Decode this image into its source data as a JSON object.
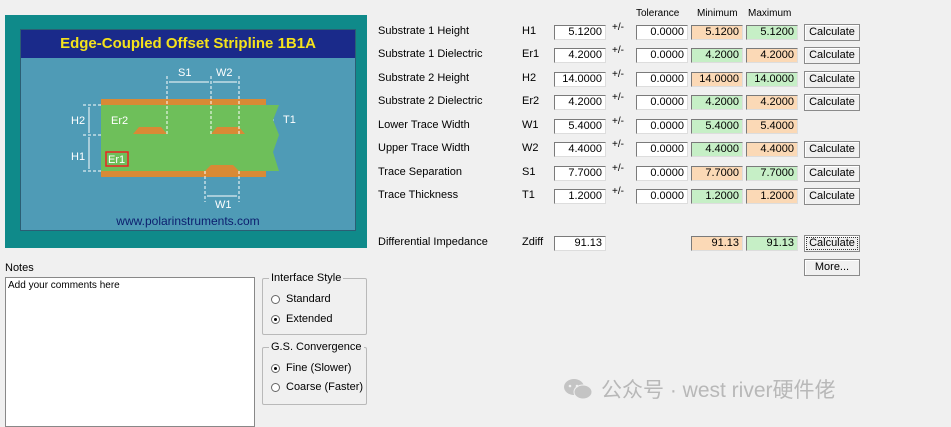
{
  "diagram": {
    "title": "Edge-Coupled Offset Stripline 1B1A",
    "url": "www.polarinstruments.com",
    "labels": {
      "s1": "S1",
      "w2": "W2",
      "t1": "T1",
      "h2": "H2",
      "er2": "Er2",
      "h1": "H1",
      "er1": "Er1",
      "w1": "W1"
    }
  },
  "headers": {
    "tolerance": "Tolerance",
    "minimum": "Minimum",
    "maximum": "Maximum"
  },
  "params": [
    {
      "label": "Substrate 1 Height",
      "symbol": "H1",
      "value": "5.1200",
      "pm": "+/-",
      "tol": "0.0000",
      "min": "5.1200",
      "max": "5.1200",
      "min_color": "peach",
      "max_color": "green",
      "button": "Calculate"
    },
    {
      "label": "Substrate 1 Dielectric",
      "symbol": "Er1",
      "value": "4.2000",
      "pm": "+/-",
      "tol": "0.0000",
      "min": "4.2000",
      "max": "4.2000",
      "min_color": "green",
      "max_color": "peach",
      "button": "Calculate"
    },
    {
      "label": "Substrate 2 Height",
      "symbol": "H2",
      "value": "14.0000",
      "pm": "+/-",
      "tol": "0.0000",
      "min": "14.0000",
      "max": "14.0000",
      "min_color": "peach",
      "max_color": "green",
      "button": "Calculate"
    },
    {
      "label": "Substrate 2 Dielectric",
      "symbol": "Er2",
      "value": "4.2000",
      "pm": "+/-",
      "tol": "0.0000",
      "min": "4.2000",
      "max": "4.2000",
      "min_color": "green",
      "max_color": "peach",
      "button": "Calculate"
    },
    {
      "label": "Lower Trace Width",
      "symbol": "W1",
      "value": "5.4000",
      "pm": "+/-",
      "tol": "0.0000",
      "min": "5.4000",
      "max": "5.4000",
      "min_color": "green",
      "max_color": "peach",
      "button": ""
    },
    {
      "label": "Upper Trace Width",
      "symbol": "W2",
      "value": "4.4000",
      "pm": "+/-",
      "tol": "0.0000",
      "min": "4.4000",
      "max": "4.4000",
      "min_color": "green",
      "max_color": "peach",
      "button": "Calculate"
    },
    {
      "label": "Trace Separation",
      "symbol": "S1",
      "value": "7.7000",
      "pm": "+/-",
      "tol": "0.0000",
      "min": "7.7000",
      "max": "7.7000",
      "min_color": "peach",
      "max_color": "green",
      "button": "Calculate"
    },
    {
      "label": "Trace Thickness",
      "symbol": "T1",
      "value": "1.2000",
      "pm": "+/-",
      "tol": "0.0000",
      "min": "1.2000",
      "max": "1.2000",
      "min_color": "green",
      "max_color": "peach",
      "button": "Calculate"
    }
  ],
  "impedance": {
    "label": "Differential Impedance",
    "symbol": "Zdiff",
    "value": "91.13",
    "min": "91.13",
    "max": "91.13",
    "button": "Calculate",
    "more": "More..."
  },
  "notes": {
    "label": "Notes",
    "text": "Add your comments here"
  },
  "interface_style": {
    "title": "Interface Style",
    "options": [
      "Standard",
      "Extended"
    ],
    "selected": 1
  },
  "convergence": {
    "title": "G.S. Convergence",
    "options": [
      "Fine (Slower)",
      "Coarse (Faster)"
    ],
    "selected": 0
  },
  "watermark": "公众号 · west river硬件佬"
}
